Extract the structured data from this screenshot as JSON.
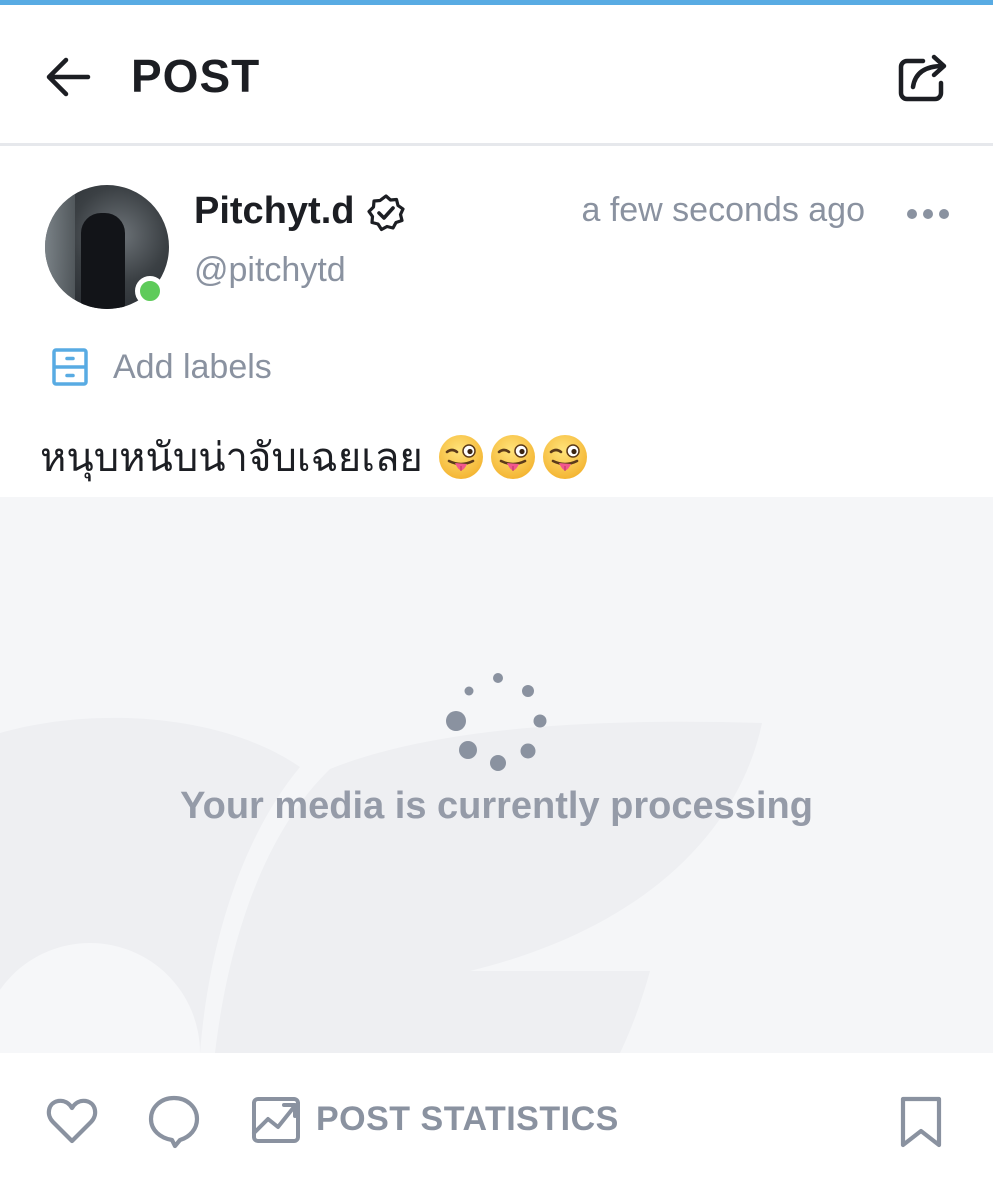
{
  "header": {
    "title": "POST",
    "back_icon": "arrow-left-icon",
    "share_icon": "share-icon"
  },
  "post": {
    "author": {
      "display_name": "Pitchyt.d",
      "handle": "@pitchytd",
      "verified_icon": "verified-badge-icon",
      "online": true
    },
    "timestamp": "a few seconds ago",
    "labels_button": "Add labels",
    "text": "หนุบหนับน่าจับเฉยเลย",
    "emojis": [
      "winking-face-with-tongue",
      "winking-face-with-tongue",
      "winking-face-with-tongue"
    ],
    "media_status": "Your media is currently processing"
  },
  "actions": {
    "stats_label": "POST STATISTICS",
    "icons": [
      "heart-icon",
      "comment-icon",
      "chart-icon",
      "bookmark-icon"
    ]
  },
  "colors": {
    "accent": "#58abe3",
    "text_primary": "#1c1e23",
    "text_secondary": "#8a92a0",
    "online": "#5ecb5a",
    "media_bg": "#f5f6f8"
  }
}
